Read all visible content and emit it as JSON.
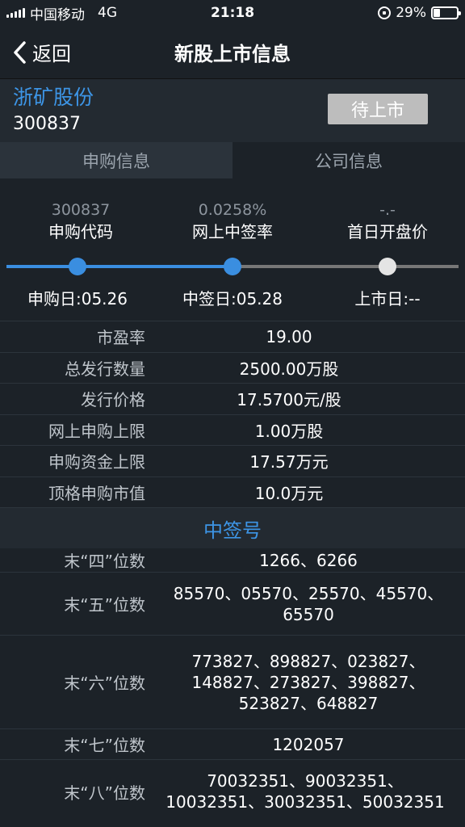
{
  "status_bar": {
    "carrier": "中国移动",
    "network": "4G",
    "time": "21:18",
    "battery": "29%",
    "battery_level": 0.29
  },
  "nav": {
    "back_label": "返回",
    "title": "新股上市信息"
  },
  "stock": {
    "name": "浙矿股份",
    "code": "300837",
    "status": "待上市"
  },
  "tabs": [
    {
      "label": "申购信息",
      "active": true
    },
    {
      "label": "公司信息",
      "active": false
    }
  ],
  "progress": {
    "steps": [
      {
        "value": "300837",
        "label": "申购代码",
        "date": "申购日:05.26"
      },
      {
        "value": "0.0258%",
        "label": "网上中签率",
        "date": "中签日:05.28"
      },
      {
        "value": "-.-",
        "label": "首日开盘价",
        "date": "上市日:--"
      }
    ],
    "completed_steps": 2
  },
  "info": [
    {
      "key": "市盈率",
      "value": "19.00"
    },
    {
      "key": "总发行数量",
      "value": "2500.00万股"
    },
    {
      "key": "发行价格",
      "value": "17.5700元/股"
    },
    {
      "key": "网上申购上限",
      "value": "1.00万股"
    },
    {
      "key": "申购资金上限",
      "value": "17.57万元"
    },
    {
      "key": "顶格申购市值",
      "value": "10.0万元"
    }
  ],
  "lottery": {
    "title": "中签号",
    "rows": [
      {
        "key": "末“四”位数",
        "lines": [
          "1266、6266"
        ]
      },
      {
        "key": "末“五”位数",
        "lines": [
          "85570、05570、25570、45570、",
          "65570"
        ]
      },
      {
        "key": "末“六”位数",
        "lines": [
          "773827、898827、023827、",
          "148827、273827、398827、",
          "523827、648827"
        ]
      },
      {
        "key": "末“七”位数",
        "lines": [
          "1202057"
        ]
      },
      {
        "key": "末“八”位数",
        "lines": [
          "70032351、90032351、",
          "10032351、30032351、50032351"
        ]
      }
    ]
  },
  "colors": {
    "accent": "#3d95e6",
    "background": "#1c2228"
  }
}
